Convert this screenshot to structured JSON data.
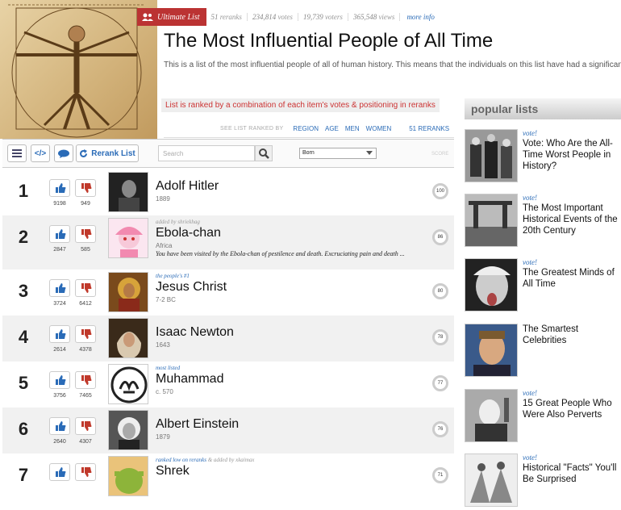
{
  "header": {
    "badge": "Ultimate List",
    "reranks_count": "51",
    "reranks_label": "reranks",
    "votes_count": "234,814",
    "votes_label": "votes",
    "voters_count": "19,739",
    "voters_label": "voters",
    "views_count": "365,548",
    "views_label": "views",
    "more_info": "more info"
  },
  "title": "The Most Influential People of All Time",
  "description": "This is a list of the most influential people of all of human history. This means that the individuals on this list have had a significant effect",
  "rank_note": "List is ranked by a combination of each item's votes & positioning in reranks",
  "filter": {
    "label": "SEE LIST RANKED BY",
    "region": "REGION",
    "age": "AGE",
    "men": "MEN",
    "women": "WOMEN",
    "reranks": "51 RERANKS"
  },
  "toolbar": {
    "rerank_label": "Rerank List",
    "embed_label": "</>",
    "search_placeholder": "Search",
    "sort_value": "Born",
    "score_label": "SCORE"
  },
  "items": [
    {
      "rank": "1",
      "name": "Adolf Hitler",
      "sub": "1889",
      "meta": "",
      "meta_extra": "",
      "blurb": "",
      "up": "9198",
      "down": "949",
      "score": "100"
    },
    {
      "rank": "2",
      "name": "Ebola-chan",
      "sub": "Africa",
      "meta": "",
      "meta_extra": "added by shriekhag",
      "blurb": "You have been visited by the Ebola-chan of pestilence and death. Excruciating pain and death ...",
      "up": "2847",
      "down": "585",
      "score": "86"
    },
    {
      "rank": "3",
      "name": "Jesus Christ",
      "sub": "7-2 BC",
      "meta": "the people's #1",
      "meta_extra": "",
      "blurb": "",
      "up": "3724",
      "down": "6412",
      "score": "80"
    },
    {
      "rank": "4",
      "name": "Isaac Newton",
      "sub": "1643",
      "meta": "",
      "meta_extra": "",
      "blurb": "",
      "up": "2614",
      "down": "4378",
      "score": "78"
    },
    {
      "rank": "5",
      "name": "Muhammad",
      "sub": "c. 570",
      "meta": "most listed",
      "meta_extra": "",
      "blurb": "",
      "up": "3756",
      "down": "7465",
      "score": "77"
    },
    {
      "rank": "6",
      "name": "Albert Einstein",
      "sub": "1879",
      "meta": "",
      "meta_extra": "",
      "blurb": "",
      "up": "2640",
      "down": "4307",
      "score": "76"
    },
    {
      "rank": "7",
      "name": "Shrek",
      "sub": "",
      "meta": "ranked low on reranks",
      "meta_extra": "& added by xkaimax",
      "blurb": "",
      "up": "",
      "down": "",
      "score": "71"
    }
  ],
  "popular": {
    "heading": "popular lists",
    "items": [
      {
        "vote": "vote!",
        "title": "Vote: Who Are the All-Time Worst People in History?"
      },
      {
        "vote": "vote!",
        "title": "The Most Important Historical Events of the 20th Century"
      },
      {
        "vote": "vote!",
        "title": "The Greatest Minds of All Time"
      },
      {
        "vote": "",
        "title": "The Smartest Celebrities"
      },
      {
        "vote": "vote!",
        "title": "15 Great People Who Were Also Perverts"
      },
      {
        "vote": "vote!",
        "title": "Historical \"Facts\" You'll Be Surprised"
      }
    ]
  },
  "colors": {
    "accent": "#2a6bb7",
    "badge": "#b33",
    "down": "#c0392b",
    "up": "#2a6bb7"
  }
}
